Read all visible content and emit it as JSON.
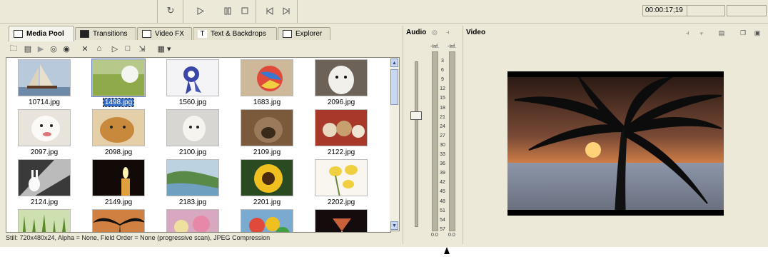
{
  "transport": {
    "buttons": [
      "loop-icon",
      "play-icon",
      "pause-icon",
      "stop-icon",
      "prev-frame-icon",
      "next-frame-icon"
    ],
    "timecode": "00:00:17;19"
  },
  "tabs": [
    {
      "label": "Media Pool",
      "icon": "media-pool-icon",
      "active": true
    },
    {
      "label": "Transitions",
      "icon": "transitions-icon",
      "active": false
    },
    {
      "label": "Video FX",
      "icon": "video-fx-icon",
      "active": false
    },
    {
      "label": "Text & Backdrops",
      "icon": "text-backdrops-icon",
      "active": false
    },
    {
      "label": "Explorer",
      "icon": "explorer-icon",
      "active": false
    }
  ],
  "media": [
    {
      "file": "10714.jpg",
      "subject": "sailboat"
    },
    {
      "file": "1498.jpg",
      "subject": "golf-ball",
      "selected": true
    },
    {
      "file": "1560.jpg",
      "subject": "award-ribbon"
    },
    {
      "file": "1683.jpg",
      "subject": "beach-ball"
    },
    {
      "file": "2096.jpg",
      "subject": "white-dog"
    },
    {
      "file": "2097.jpg",
      "subject": "dog-face"
    },
    {
      "file": "2098.jpg",
      "subject": "golden-retriever"
    },
    {
      "file": "2100.jpg",
      "subject": "poodle"
    },
    {
      "file": "2109.jpg",
      "subject": "orangutan"
    },
    {
      "file": "2122.jpg",
      "subject": "teddy-bears"
    },
    {
      "file": "2124.jpg",
      "subject": "rabbit"
    },
    {
      "file": "2149.jpg",
      "subject": "candle"
    },
    {
      "file": "2183.jpg",
      "subject": "coast"
    },
    {
      "file": "2201.jpg",
      "subject": "sunflower"
    },
    {
      "file": "2202.jpg",
      "subject": "tulips"
    },
    {
      "file": "",
      "subject": "grass"
    },
    {
      "file": "",
      "subject": "palm-silhouette"
    },
    {
      "file": "",
      "subject": "flowers"
    },
    {
      "file": "",
      "subject": "balloons"
    },
    {
      "file": "",
      "subject": "cocktail"
    }
  ],
  "status": "Still: 720x480x24, Alpha = None, Field Order = None (progressive scan), JPEG Compression",
  "audio": {
    "title": "Audio",
    "inf_left": "-Inf.",
    "inf_right": "-Inf.",
    "scale": [
      "3",
      "6",
      "9",
      "12",
      "15",
      "18",
      "21",
      "24",
      "27",
      "30",
      "33",
      "36",
      "39",
      "42",
      "45",
      "48",
      "51",
      "54",
      "57"
    ],
    "zero_left": "0.0",
    "zero_right": "0.0"
  },
  "video": {
    "title": "Video"
  },
  "colors": {
    "chrome": "#ece9d8",
    "selection": "#316ac5",
    "sky_top": "#3a2418",
    "sky_bottom": "#e58a4a",
    "sea": "#8a96a6"
  }
}
